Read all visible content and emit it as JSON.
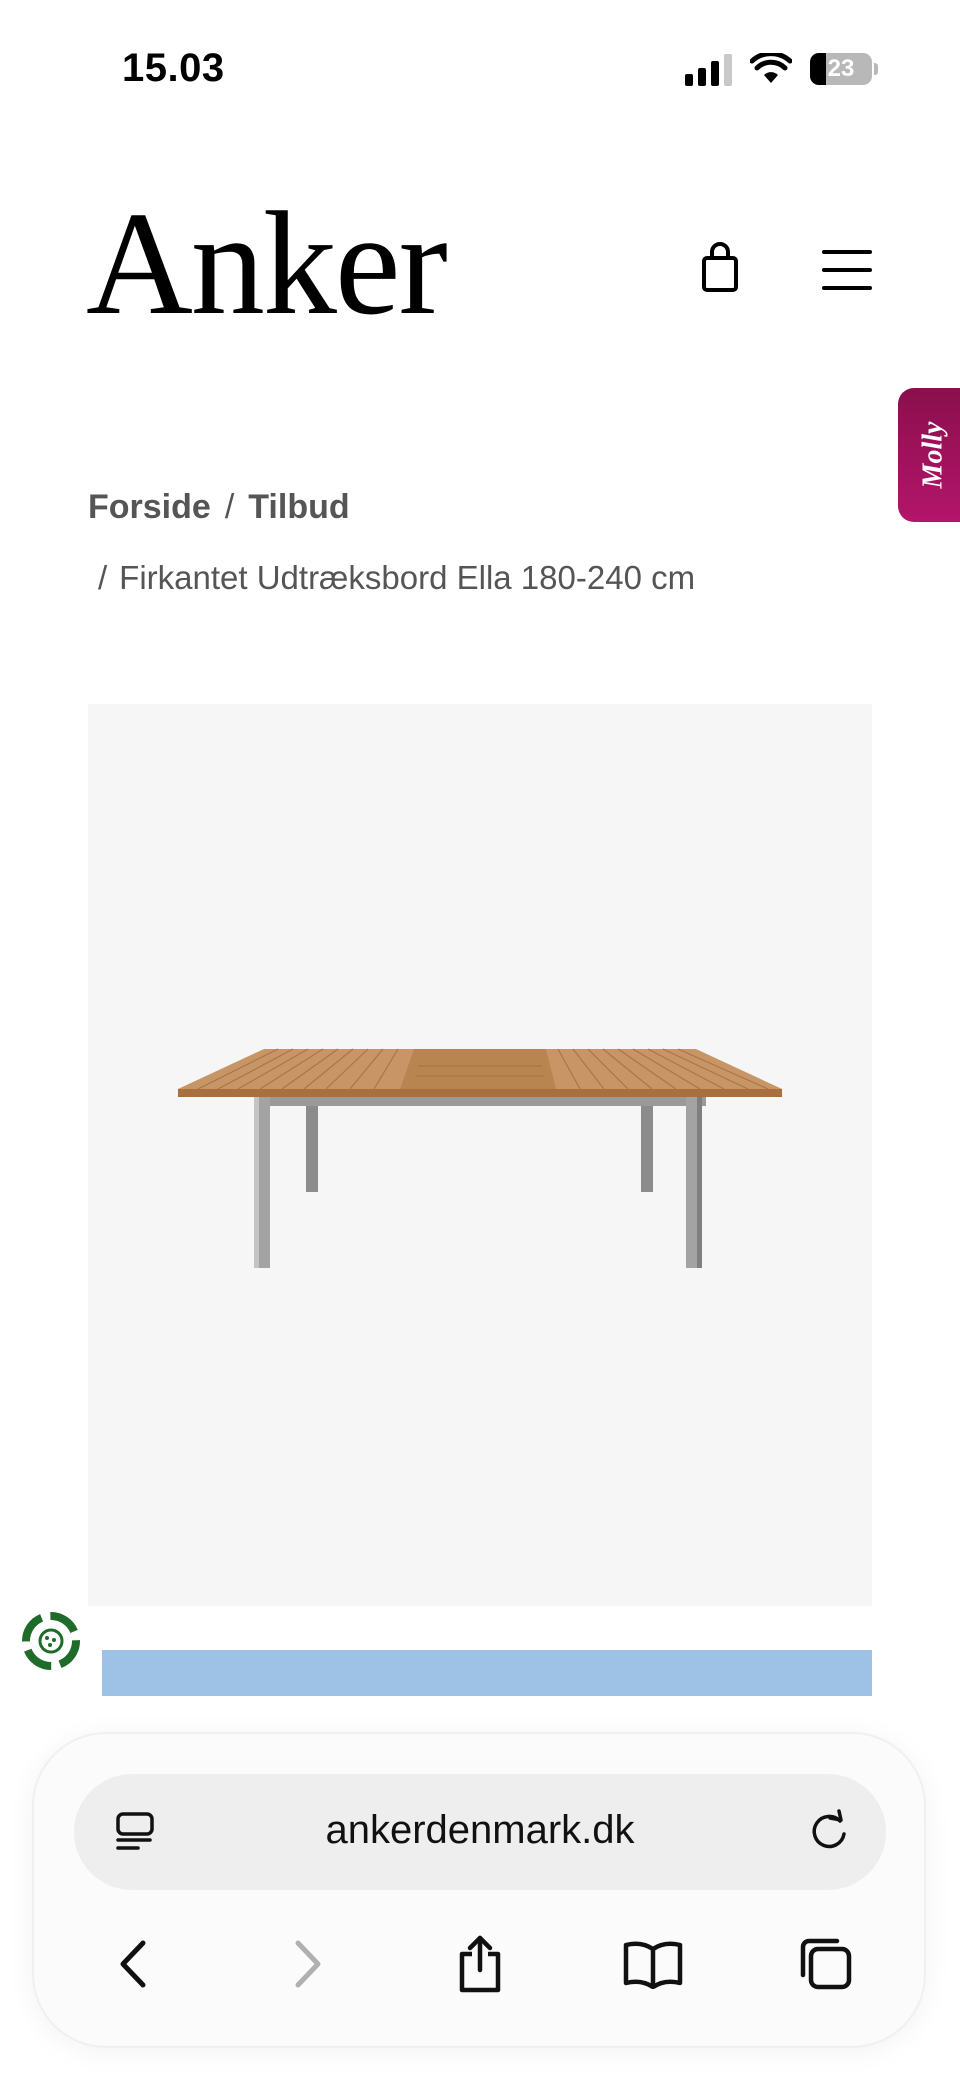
{
  "status_bar": {
    "time": "15.03",
    "battery": "23",
    "icons": [
      "cellular-signal-icon",
      "wifi-icon",
      "battery-icon"
    ]
  },
  "header": {
    "logo": "Anker",
    "cart_icon": "shopping-bag-icon",
    "menu_icon": "hamburger-menu-icon"
  },
  "chat_widget": {
    "label": "Molly"
  },
  "breadcrumb": {
    "home": "Forside",
    "separator": "/",
    "category": "Tilbud",
    "current": "Firkantet Udtræksbord Ella 180-240 cm"
  },
  "product": {
    "image_icon": "teak-extendable-table-image"
  },
  "browser": {
    "url": "ankerdenmark.dk",
    "icons": [
      "reader-icon",
      "reload-icon",
      "back-icon",
      "forward-icon",
      "share-icon",
      "bookmarks-icon",
      "tabs-icon"
    ]
  },
  "colors": {
    "molly_accent": "#a0135c",
    "recycle_green": "#1f6b2a",
    "strip_blue": "#9dc2e6"
  }
}
